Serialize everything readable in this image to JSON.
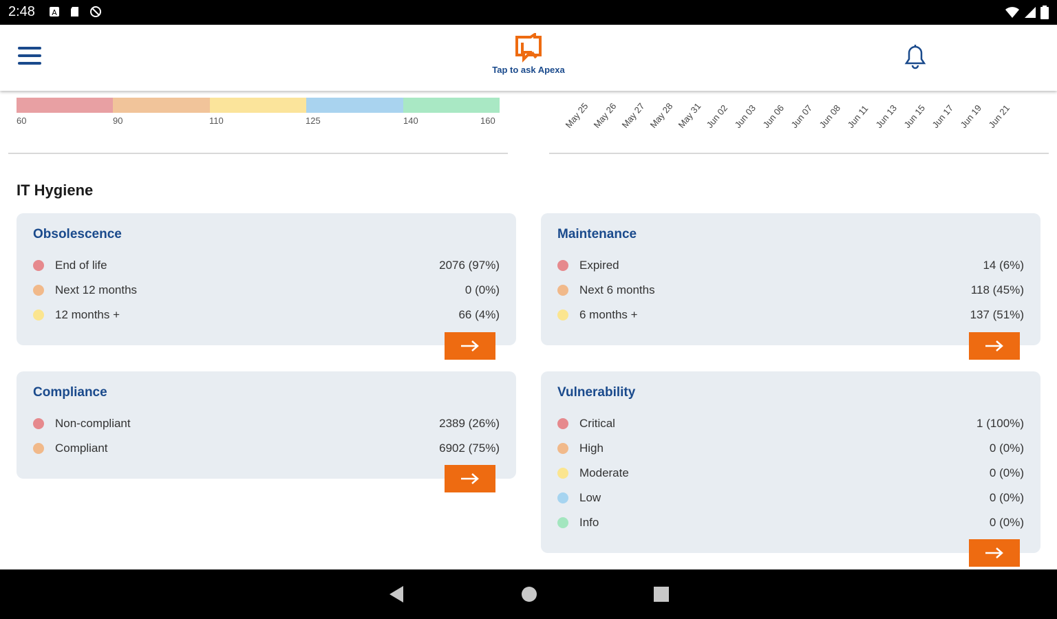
{
  "status_bar": {
    "time": "2:48"
  },
  "header": {
    "ask_label": "Tap to ask Apexa"
  },
  "gauge": {
    "colors": [
      "#e8a0a3",
      "#f1c49a",
      "#fbe49b",
      "#a9d3ef",
      "#a9e8c4"
    ],
    "ticks": [
      "60",
      "90",
      "110",
      "125",
      "140",
      "160"
    ]
  },
  "date_axis": [
    "May 25",
    "May 26",
    "May 27",
    "May 28",
    "May 31",
    "Jun 02",
    "Jun 03",
    "Jun 06",
    "Jun 07",
    "Jun 08",
    "Jun 11",
    "Jun 13",
    "Jun 15",
    "Jun 17",
    "Jun 19",
    "Jun 21"
  ],
  "section_title": "IT Hygiene",
  "colors": {
    "red": "#e6898d",
    "orange": "#f1b98a",
    "yellow": "#fbe58f",
    "blue": "#a6d4f0",
    "green": "#a3e6bf",
    "accent": "#ee6b11",
    "title": "#1a4a8c"
  },
  "obsolescence": {
    "title": "Obsolescence",
    "rows": [
      {
        "label": "End of life",
        "value": "2076 (97%)"
      },
      {
        "label": "Next 12 months",
        "value": "0 (0%)"
      },
      {
        "label": "12 months +",
        "value": "66 (4%)"
      }
    ]
  },
  "maintenance": {
    "title": "Maintenance",
    "rows": [
      {
        "label": "Expired",
        "value": "14 (6%)"
      },
      {
        "label": "Next 6 months",
        "value": "118 (45%)"
      },
      {
        "label": "6 months +",
        "value": "137 (51%)"
      }
    ]
  },
  "compliance": {
    "title": "Compliance",
    "rows": [
      {
        "label": "Non-compliant",
        "value": "2389 (26%)"
      },
      {
        "label": "Compliant",
        "value": "6902 (75%)"
      }
    ]
  },
  "vulnerability": {
    "title": "Vulnerability",
    "rows": [
      {
        "label": "Critical",
        "value": "1 (100%)"
      },
      {
        "label": "High",
        "value": "0 (0%)"
      },
      {
        "label": "Moderate",
        "value": "0 (0%)"
      },
      {
        "label": "Low",
        "value": "0 (0%)"
      },
      {
        "label": "Info",
        "value": "0 (0%)"
      }
    ]
  }
}
